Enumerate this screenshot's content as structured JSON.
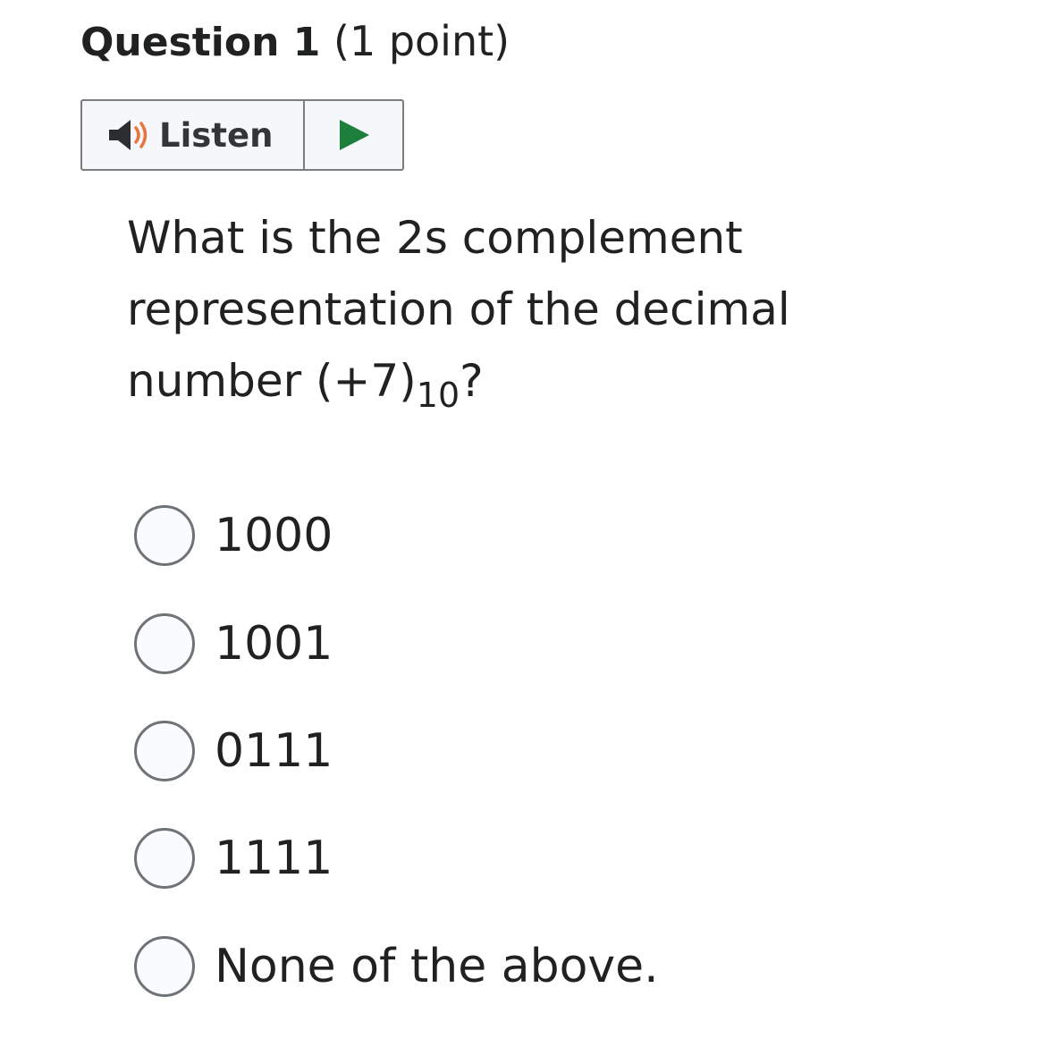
{
  "question": {
    "title": "Question 1",
    "points": "(1 point)"
  },
  "listen": {
    "label": "Listen",
    "speaker_icon": "speaker-icon",
    "play_icon": "play-icon",
    "colors": {
      "speaker": "#2b2d30",
      "sound_waves": "#e8743b",
      "play": "#1e7f3c"
    }
  },
  "prompt": {
    "text_before": "What is the 2s complement representation of the decimal number (+7)",
    "subscript": "10",
    "text_after": "?"
  },
  "options": [
    {
      "label": "1000",
      "selected": false
    },
    {
      "label": "1001",
      "selected": false
    },
    {
      "label": "0111",
      "selected": false
    },
    {
      "label": "1111",
      "selected": false
    },
    {
      "label": "None of the above.",
      "selected": false
    }
  ]
}
